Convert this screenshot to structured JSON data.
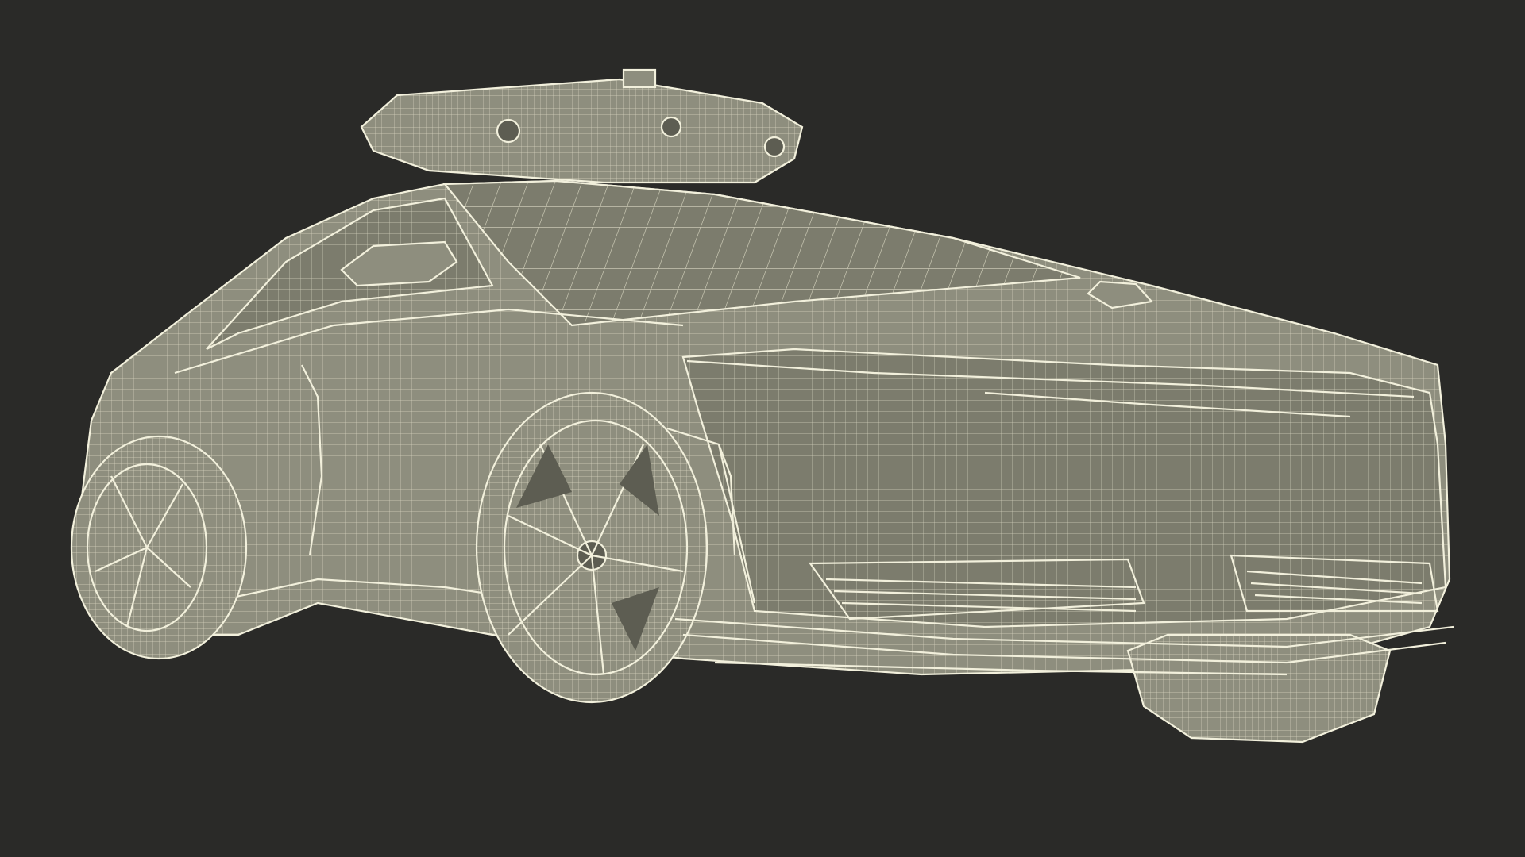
{
  "scene": {
    "subject": "wireframe-car-render",
    "colors": {
      "background": "#2a2a28",
      "mesh_fill": "#8e8e7e",
      "wire": "#e8e6cf"
    }
  }
}
